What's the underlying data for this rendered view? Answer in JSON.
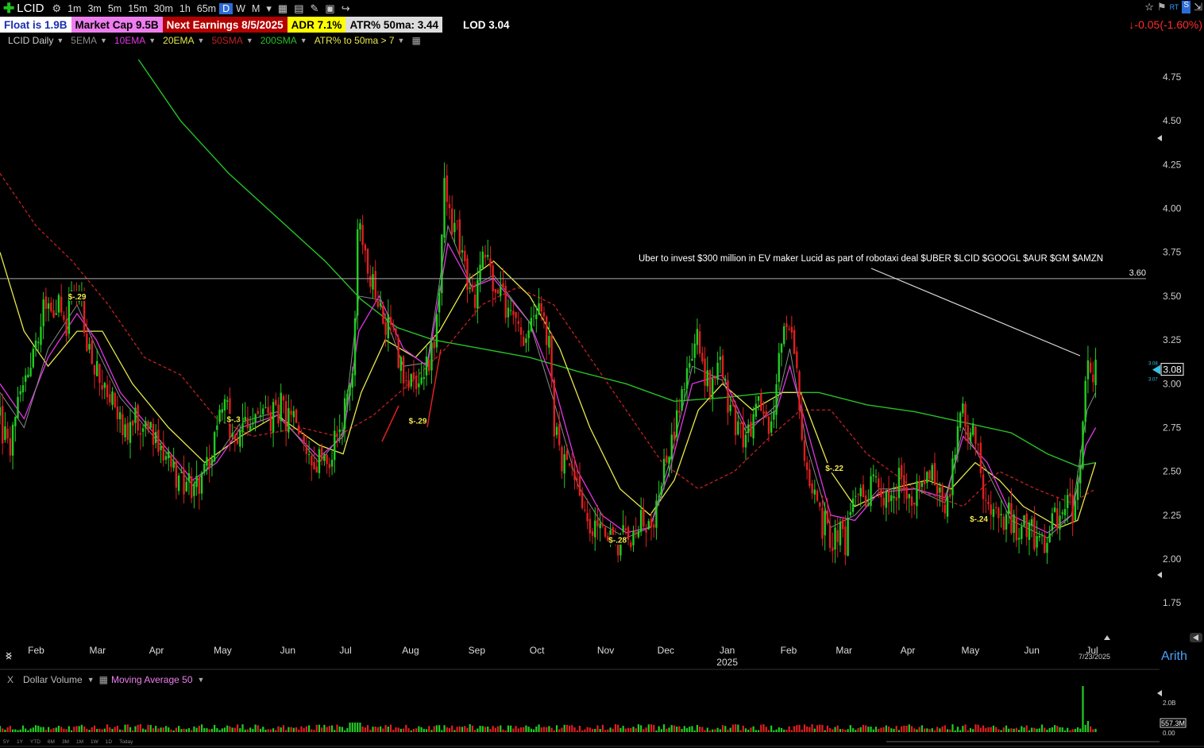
{
  "toolbar": {
    "symbol": "LCID",
    "timeframes": [
      "1m",
      "3m",
      "5m",
      "15m",
      "30m",
      "1h",
      "65m",
      "D",
      "W",
      "M"
    ],
    "active_timeframe": "D"
  },
  "infobar": {
    "float": "Float is 1.9B",
    "market_cap": "Market Cap 9.5B",
    "earnings": "Next Earnings 8/5/2025",
    "adr": "ADR  7.1%",
    "atr": "ATR% 50ma:  3.44",
    "lod": "LOD 3.04"
  },
  "price_change": "↓-0.05(-1.60%)",
  "legend": {
    "symbol": "LCID Daily",
    "ema5": "5EMA",
    "ema10": "10EMA",
    "ema20": "20EMA",
    "sma50": "50SMA",
    "sma200": "200SMA",
    "atr": "ATR% to 50ma > 7"
  },
  "colors": {
    "up": "#22cc22",
    "down": "#e01f1f",
    "ema5": "#8a8a8a",
    "ema10": "#e236e2",
    "ema20": "#e8e84c",
    "sma50": "#c42020",
    "sma200": "#26c226"
  },
  "volume_bar": {
    "label": "Dollar Volume",
    "ma_label": "Moving Average 50",
    "axis_top": "2.0B",
    "axis_mid": "0.00",
    "current": "557.3M"
  },
  "bottom_timeframes": [
    "5Y",
    "1Y",
    "YTD",
    "6M",
    "3M",
    "1M",
    "1W",
    "1D",
    "Today"
  ],
  "scale_mode": "Arith",
  "chart_data": {
    "type": "candlestick",
    "title": "LCID Daily",
    "ylim": [
      1.55,
      4.95
    ],
    "y_ticks": [
      1.75,
      2.0,
      2.25,
      2.5,
      2.75,
      3.0,
      3.25,
      3.5,
      3.75,
      4.0,
      4.25,
      4.5,
      4.75
    ],
    "x_months": [
      {
        "label": "Feb",
        "pos": 0.03
      },
      {
        "label": "Mar",
        "pos": 0.081
      },
      {
        "label": "Apr",
        "pos": 0.13
      },
      {
        "label": "May",
        "pos": 0.185
      },
      {
        "label": "Jun",
        "pos": 0.239
      },
      {
        "label": "Jul",
        "pos": 0.287
      },
      {
        "label": "Aug",
        "pos": 0.341
      },
      {
        "label": "Sep",
        "pos": 0.396
      },
      {
        "label": "Oct",
        "pos": 0.446
      },
      {
        "label": "Nov",
        "pos": 0.503
      },
      {
        "label": "Dec",
        "pos": 0.553
      },
      {
        "label": "Jan",
        "pos": 0.604
      },
      {
        "label": "Feb",
        "pos": 0.655
      },
      {
        "label": "Mar",
        "pos": 0.701
      },
      {
        "label": "Apr",
        "pos": 0.754
      },
      {
        "label": "May",
        "pos": 0.806
      },
      {
        "label": "Jun",
        "pos": 0.857
      },
      {
        "label": "Jul",
        "pos": 0.907
      }
    ],
    "year_label": {
      "label": "2025",
      "pos": 0.604
    },
    "last_date": "7/23/2025",
    "current_price": "3.08",
    "price_tag_small_a": "3.08",
    "price_tag_small_b": "3.07",
    "horizontal_line": {
      "value": 3.6,
      "label": "3.60"
    },
    "annotation": "Uber to invest $300 million in EV maker Lucid as part of robotaxi deal $UBER $LCID $GOOGL $AUR $GM $AMZN",
    "earnings_markers": [
      {
        "label": "$-.29",
        "pos": 0.064,
        "value": 3.5
      },
      {
        "label": "$-.3",
        "pos": 0.194,
        "value": 2.8
      },
      {
        "label": "$-.29",
        "pos": 0.347,
        "value": 2.79
      },
      {
        "label": "$-.28",
        "pos": 0.513,
        "value": 2.11
      },
      {
        "label": "$-.22",
        "pos": 0.693,
        "value": 2.52
      },
      {
        "label": "$-.24",
        "pos": 0.813,
        "value": 2.23
      }
    ],
    "price_path": [
      [
        0.0,
        2.8
      ],
      [
        0.006,
        2.62
      ],
      [
        0.012,
        2.75
      ],
      [
        0.018,
        2.95
      ],
      [
        0.024,
        3.05
      ],
      [
        0.03,
        3.3
      ],
      [
        0.036,
        3.4
      ],
      [
        0.042,
        3.42
      ],
      [
        0.048,
        3.45
      ],
      [
        0.055,
        3.3
      ],
      [
        0.06,
        3.5
      ],
      [
        0.066,
        3.55
      ],
      [
        0.071,
        3.25
      ],
      [
        0.077,
        3.1
      ],
      [
        0.083,
        3.0
      ],
      [
        0.09,
        2.92
      ],
      [
        0.097,
        2.9
      ],
      [
        0.104,
        2.7
      ],
      [
        0.112,
        2.78
      ],
      [
        0.12,
        2.75
      ],
      [
        0.128,
        2.68
      ],
      [
        0.136,
        2.6
      ],
      [
        0.144,
        2.5
      ],
      [
        0.152,
        2.42
      ],
      [
        0.16,
        2.38
      ],
      [
        0.168,
        2.48
      ],
      [
        0.176,
        2.55
      ],
      [
        0.182,
        2.9
      ],
      [
        0.19,
        2.8
      ],
      [
        0.197,
        2.65
      ],
      [
        0.205,
        2.78
      ],
      [
        0.213,
        2.82
      ],
      [
        0.222,
        2.8
      ],
      [
        0.232,
        2.86
      ],
      [
        0.24,
        2.8
      ],
      [
        0.248,
        2.7
      ],
      [
        0.256,
        2.6
      ],
      [
        0.264,
        2.53
      ],
      [
        0.272,
        2.55
      ],
      [
        0.28,
        2.68
      ],
      [
        0.288,
        2.85
      ],
      [
        0.293,
        3.1
      ],
      [
        0.298,
        4.0
      ],
      [
        0.303,
        3.7
      ],
      [
        0.308,
        3.55
      ],
      [
        0.314,
        3.45
      ],
      [
        0.32,
        3.3
      ],
      [
        0.326,
        3.4
      ],
      [
        0.332,
        3.1
      ],
      [
        0.338,
        2.95
      ],
      [
        0.344,
        3.05
      ],
      [
        0.35,
        2.98
      ],
      [
        0.356,
        3.1
      ],
      [
        0.36,
        3.2
      ],
      [
        0.364,
        3.45
      ],
      [
        0.369,
        4.1
      ],
      [
        0.374,
        3.95
      ],
      [
        0.38,
        3.85
      ],
      [
        0.386,
        3.65
      ],
      [
        0.392,
        3.45
      ],
      [
        0.398,
        3.6
      ],
      [
        0.404,
        3.75
      ],
      [
        0.41,
        3.55
      ],
      [
        0.418,
        3.5
      ],
      [
        0.426,
        3.4
      ],
      [
        0.432,
        3.2
      ],
      [
        0.44,
        3.35
      ],
      [
        0.448,
        3.4
      ],
      [
        0.455,
        3.3
      ],
      [
        0.46,
        2.8
      ],
      [
        0.466,
        2.55
      ],
      [
        0.472,
        2.5
      ],
      [
        0.478,
        2.42
      ],
      [
        0.484,
        2.3
      ],
      [
        0.49,
        2.2
      ],
      [
        0.496,
        2.15
      ],
      [
        0.502,
        2.2
      ],
      [
        0.508,
        2.1
      ],
      [
        0.514,
        2.05
      ],
      [
        0.52,
        2.15
      ],
      [
        0.526,
        2.12
      ],
      [
        0.532,
        2.2
      ],
      [
        0.538,
        2.15
      ],
      [
        0.544,
        2.2
      ],
      [
        0.548,
        2.4
      ],
      [
        0.553,
        2.55
      ],
      [
        0.558,
        2.7
      ],
      [
        0.564,
        2.85
      ],
      [
        0.57,
        3.0
      ],
      [
        0.574,
        3.2
      ],
      [
        0.579,
        3.25
      ],
      [
        0.584,
        3.05
      ],
      [
        0.59,
        2.95
      ],
      [
        0.596,
        3.1
      ],
      [
        0.602,
        3.0
      ],
      [
        0.608,
        2.8
      ],
      [
        0.614,
        2.72
      ],
      [
        0.62,
        2.65
      ],
      [
        0.626,
        2.8
      ],
      [
        0.632,
        2.85
      ],
      [
        0.638,
        2.75
      ],
      [
        0.644,
        2.88
      ],
      [
        0.65,
        3.35
      ],
      [
        0.656,
        3.3
      ],
      [
        0.662,
        3.0
      ],
      [
        0.667,
        2.65
      ],
      [
        0.672,
        2.4
      ],
      [
        0.678,
        2.3
      ],
      [
        0.684,
        2.2
      ],
      [
        0.69,
        2.1
      ],
      [
        0.696,
        2.15
      ],
      [
        0.702,
        2.08
      ],
      [
        0.708,
        2.3
      ],
      [
        0.714,
        2.4
      ],
      [
        0.72,
        2.35
      ],
      [
        0.726,
        2.45
      ],
      [
        0.732,
        2.38
      ],
      [
        0.738,
        2.3
      ],
      [
        0.744,
        2.4
      ],
      [
        0.75,
        2.45
      ],
      [
        0.756,
        2.3
      ],
      [
        0.762,
        2.35
      ],
      [
        0.768,
        2.5
      ],
      [
        0.774,
        2.45
      ],
      [
        0.78,
        2.38
      ],
      [
        0.786,
        2.3
      ],
      [
        0.792,
        2.55
      ],
      [
        0.798,
        2.85
      ],
      [
        0.803,
        2.75
      ],
      [
        0.808,
        2.7
      ],
      [
        0.814,
        2.55
      ],
      [
        0.82,
        2.3
      ],
      [
        0.826,
        2.25
      ],
      [
        0.832,
        2.2
      ],
      [
        0.838,
        2.22
      ],
      [
        0.844,
        2.18
      ],
      [
        0.85,
        2.15
      ],
      [
        0.856,
        2.2
      ],
      [
        0.862,
        2.12
      ],
      [
        0.868,
        2.08
      ],
      [
        0.874,
        2.2
      ],
      [
        0.88,
        2.25
      ],
      [
        0.886,
        2.28
      ],
      [
        0.892,
        2.3
      ],
      [
        0.898,
        2.6
      ],
      [
        0.903,
        3.15
      ],
      [
        0.907,
        2.9
      ],
      [
        0.91,
        3.08
      ]
    ],
    "ema10_path": [
      [
        0.0,
        3.0
      ],
      [
        0.02,
        2.8
      ],
      [
        0.04,
        3.15
      ],
      [
        0.064,
        3.4
      ],
      [
        0.08,
        3.25
      ],
      [
        0.1,
        2.95
      ],
      [
        0.13,
        2.7
      ],
      [
        0.16,
        2.45
      ],
      [
        0.18,
        2.55
      ],
      [
        0.2,
        2.75
      ],
      [
        0.23,
        2.82
      ],
      [
        0.265,
        2.58
      ],
      [
        0.285,
        2.7
      ],
      [
        0.298,
        3.3
      ],
      [
        0.315,
        3.5
      ],
      [
        0.335,
        3.2
      ],
      [
        0.355,
        3.1
      ],
      [
        0.372,
        3.8
      ],
      [
        0.392,
        3.55
      ],
      [
        0.41,
        3.6
      ],
      [
        0.44,
        3.35
      ],
      [
        0.46,
        3.0
      ],
      [
        0.48,
        2.5
      ],
      [
        0.5,
        2.25
      ],
      [
        0.52,
        2.15
      ],
      [
        0.54,
        2.18
      ],
      [
        0.556,
        2.5
      ],
      [
        0.575,
        3.0
      ],
      [
        0.6,
        3.05
      ],
      [
        0.62,
        2.75
      ],
      [
        0.645,
        2.85
      ],
      [
        0.656,
        3.1
      ],
      [
        0.67,
        2.75
      ],
      [
        0.69,
        2.25
      ],
      [
        0.71,
        2.22
      ],
      [
        0.73,
        2.38
      ],
      [
        0.76,
        2.4
      ],
      [
        0.785,
        2.35
      ],
      [
        0.8,
        2.7
      ],
      [
        0.82,
        2.55
      ],
      [
        0.84,
        2.25
      ],
      [
        0.87,
        2.15
      ],
      [
        0.89,
        2.25
      ],
      [
        0.902,
        2.65
      ],
      [
        0.91,
        2.75
      ]
    ],
    "ema5_path": [
      [
        0.0,
        2.95
      ],
      [
        0.02,
        2.75
      ],
      [
        0.04,
        3.2
      ],
      [
        0.064,
        3.45
      ],
      [
        0.08,
        3.2
      ],
      [
        0.1,
        2.92
      ],
      [
        0.13,
        2.68
      ],
      [
        0.16,
        2.42
      ],
      [
        0.18,
        2.58
      ],
      [
        0.2,
        2.78
      ],
      [
        0.23,
        2.84
      ],
      [
        0.265,
        2.55
      ],
      [
        0.285,
        2.72
      ],
      [
        0.298,
        3.5
      ],
      [
        0.315,
        3.48
      ],
      [
        0.335,
        3.1
      ],
      [
        0.355,
        3.12
      ],
      [
        0.372,
        3.9
      ],
      [
        0.392,
        3.55
      ],
      [
        0.41,
        3.62
      ],
      [
        0.44,
        3.35
      ],
      [
        0.46,
        2.9
      ],
      [
        0.48,
        2.42
      ],
      [
        0.5,
        2.2
      ],
      [
        0.52,
        2.12
      ],
      [
        0.54,
        2.18
      ],
      [
        0.556,
        2.55
      ],
      [
        0.575,
        3.1
      ],
      [
        0.6,
        3.02
      ],
      [
        0.62,
        2.72
      ],
      [
        0.645,
        2.88
      ],
      [
        0.656,
        3.2
      ],
      [
        0.67,
        2.65
      ],
      [
        0.69,
        2.18
      ],
      [
        0.71,
        2.25
      ],
      [
        0.73,
        2.4
      ],
      [
        0.76,
        2.4
      ],
      [
        0.785,
        2.32
      ],
      [
        0.8,
        2.75
      ],
      [
        0.82,
        2.5
      ],
      [
        0.84,
        2.22
      ],
      [
        0.87,
        2.12
      ],
      [
        0.89,
        2.25
      ],
      [
        0.903,
        2.85
      ],
      [
        0.91,
        2.95
      ]
    ],
    "ema20_path": [
      [
        0.0,
        3.75
      ],
      [
        0.02,
        3.3
      ],
      [
        0.04,
        3.1
      ],
      [
        0.064,
        3.3
      ],
      [
        0.085,
        3.3
      ],
      [
        0.11,
        3.0
      ],
      [
        0.14,
        2.75
      ],
      [
        0.17,
        2.55
      ],
      [
        0.2,
        2.7
      ],
      [
        0.23,
        2.82
      ],
      [
        0.265,
        2.65
      ],
      [
        0.285,
        2.6
      ],
      [
        0.3,
        2.95
      ],
      [
        0.32,
        3.25
      ],
      [
        0.345,
        3.15
      ],
      [
        0.365,
        3.3
      ],
      [
        0.39,
        3.6
      ],
      [
        0.41,
        3.7
      ],
      [
        0.44,
        3.5
      ],
      [
        0.465,
        3.2
      ],
      [
        0.49,
        2.75
      ],
      [
        0.515,
        2.4
      ],
      [
        0.54,
        2.25
      ],
      [
        0.56,
        2.45
      ],
      [
        0.58,
        2.85
      ],
      [
        0.6,
        3.0
      ],
      [
        0.625,
        2.85
      ],
      [
        0.65,
        2.95
      ],
      [
        0.665,
        2.95
      ],
      [
        0.69,
        2.5
      ],
      [
        0.71,
        2.3
      ],
      [
        0.74,
        2.4
      ],
      [
        0.77,
        2.45
      ],
      [
        0.79,
        2.4
      ],
      [
        0.81,
        2.55
      ],
      [
        0.83,
        2.45
      ],
      [
        0.85,
        2.3
      ],
      [
        0.88,
        2.18
      ],
      [
        0.895,
        2.22
      ],
      [
        0.91,
        2.55
      ]
    ],
    "sma50_path": [
      [
        0.0,
        4.2
      ],
      [
        0.03,
        3.9
      ],
      [
        0.06,
        3.7
      ],
      [
        0.09,
        3.45
      ],
      [
        0.12,
        3.15
      ],
      [
        0.15,
        3.05
      ],
      [
        0.18,
        2.8
      ],
      [
        0.21,
        2.7
      ],
      [
        0.25,
        2.75
      ],
      [
        0.28,
        2.7
      ],
      [
        0.31,
        2.82
      ],
      [
        0.34,
        3.0
      ],
      [
        0.37,
        3.2
      ],
      [
        0.4,
        3.45
      ],
      [
        0.43,
        3.55
      ],
      [
        0.46,
        3.45
      ],
      [
        0.49,
        3.15
      ],
      [
        0.52,
        2.85
      ],
      [
        0.55,
        2.55
      ],
      [
        0.58,
        2.4
      ],
      [
        0.61,
        2.5
      ],
      [
        0.64,
        2.7
      ],
      [
        0.665,
        2.85
      ],
      [
        0.69,
        2.85
      ],
      [
        0.72,
        2.6
      ],
      [
        0.76,
        2.4
      ],
      [
        0.8,
        2.3
      ],
      [
        0.83,
        2.5
      ],
      [
        0.86,
        2.4
      ],
      [
        0.89,
        2.32
      ],
      [
        0.91,
        2.4
      ]
    ],
    "sma200_path": [
      [
        0.115,
        4.85
      ],
      [
        0.15,
        4.5
      ],
      [
        0.19,
        4.2
      ],
      [
        0.23,
        3.95
      ],
      [
        0.27,
        3.7
      ],
      [
        0.3,
        3.48
      ],
      [
        0.33,
        3.32
      ],
      [
        0.36,
        3.25
      ],
      [
        0.4,
        3.2
      ],
      [
        0.44,
        3.15
      ],
      [
        0.48,
        3.07
      ],
      [
        0.52,
        3.0
      ],
      [
        0.56,
        2.9
      ],
      [
        0.6,
        2.92
      ],
      [
        0.64,
        2.95
      ],
      [
        0.68,
        2.95
      ],
      [
        0.72,
        2.88
      ],
      [
        0.76,
        2.84
      ],
      [
        0.8,
        2.78
      ],
      [
        0.84,
        2.72
      ],
      [
        0.87,
        2.6
      ],
      [
        0.895,
        2.53
      ],
      [
        0.91,
        2.55
      ]
    ],
    "volume_spike_pos": 0.899
  }
}
